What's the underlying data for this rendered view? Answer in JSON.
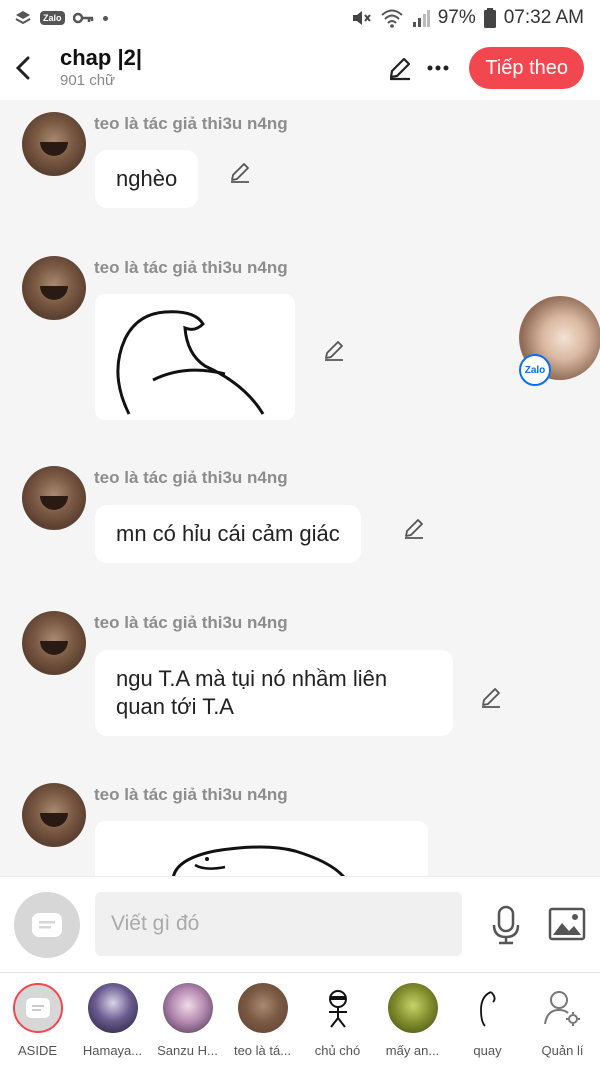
{
  "status_bar": {
    "battery": "97%",
    "time": "07:32 AM",
    "app_badge": "Zalo"
  },
  "header": {
    "title": "chap |2|",
    "subtitle": "901 chữ",
    "next_label": "Tiếp theo"
  },
  "messages": [
    {
      "sender": "teo là tác giả thi3u n4ng",
      "type": "text",
      "text": "nghèo"
    },
    {
      "sender": "teo là tác giả thi3u n4ng",
      "type": "image",
      "image": "drawing-sketch"
    },
    {
      "sender": "teo là tác giả thi3u n4ng",
      "type": "text",
      "text": "mn có hỉu cái cảm giác"
    },
    {
      "sender": "teo là tác giả thi3u n4ng",
      "type": "text",
      "text": "ngu T.A mà tụi nó nhầm liên quan tới T.A"
    },
    {
      "sender": "teo là tác giả thi3u n4ng",
      "type": "image",
      "image": "drawing-sketch"
    }
  ],
  "floating_bubble": {
    "badge": "Zalo"
  },
  "composer": {
    "placeholder": "Viết gì đó"
  },
  "bottom_nav": [
    {
      "label": "ASIDE",
      "icon": "aside-icon"
    },
    {
      "label": "Hamaya...",
      "icon": "avatar"
    },
    {
      "label": "Sanzu H...",
      "icon": "avatar"
    },
    {
      "label": "teo là tá...",
      "icon": "avatar"
    },
    {
      "label": "chủ chó",
      "icon": "avatar"
    },
    {
      "label": "mấy an...",
      "icon": "avatar"
    },
    {
      "label": "quay",
      "icon": "avatar"
    },
    {
      "label": "Quản lí",
      "icon": "user-gear-icon"
    }
  ],
  "colors": {
    "accent": "#f2474f",
    "background": "#f5f5f5"
  }
}
